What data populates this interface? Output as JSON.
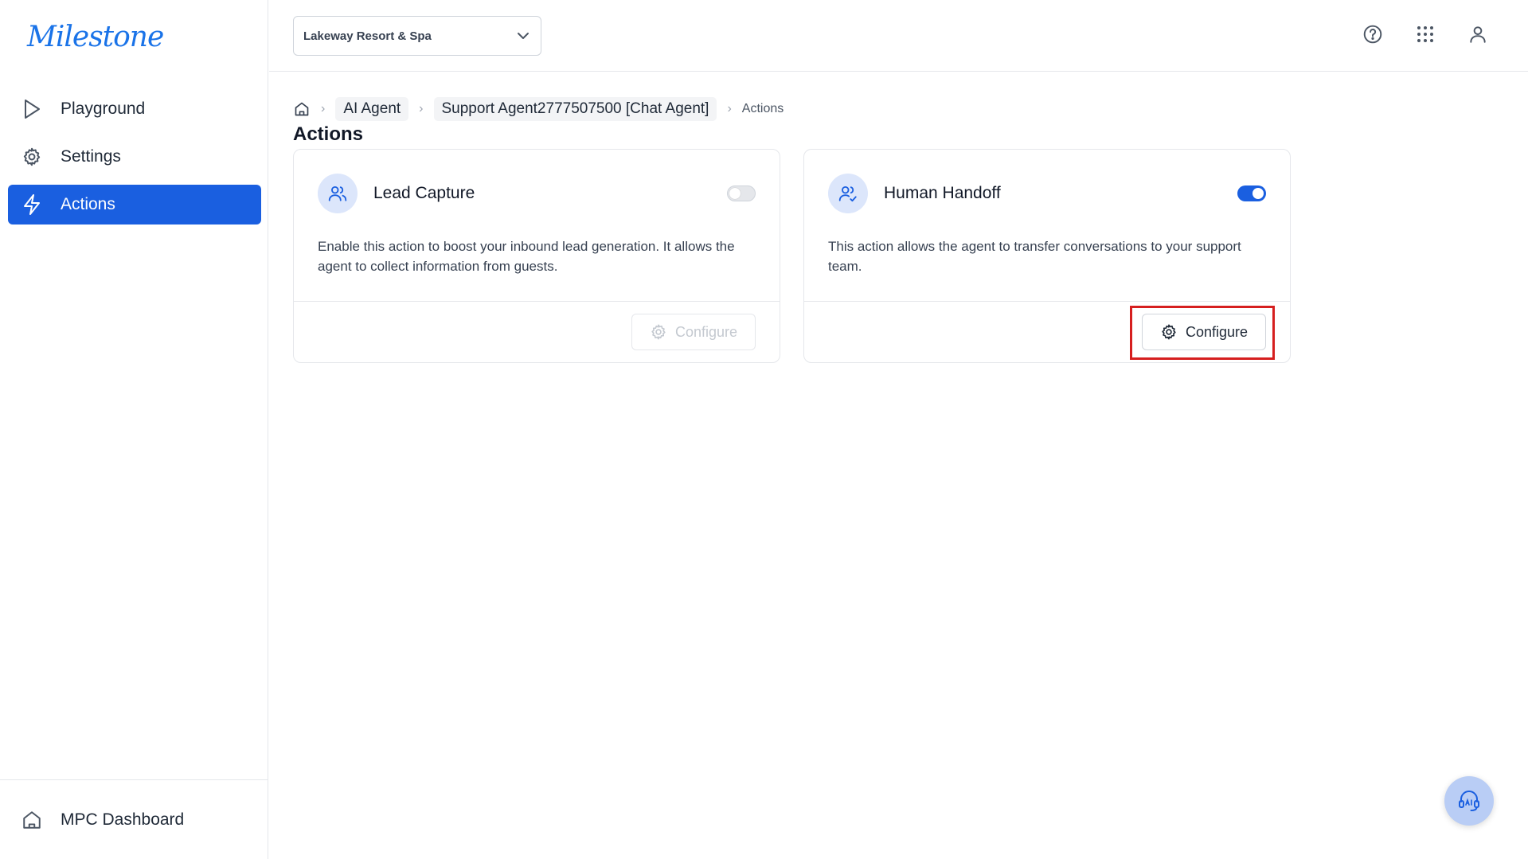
{
  "brand": {
    "logo_text": "Milestone",
    "color": "#1a73e8"
  },
  "sidebar": {
    "items": [
      {
        "label": "Playground",
        "icon": "play-icon",
        "active": false
      },
      {
        "label": "Settings",
        "icon": "gear-icon",
        "active": false
      },
      {
        "label": "Actions",
        "icon": "lightning-icon",
        "active": true
      }
    ],
    "footer": {
      "label": "MPC Dashboard",
      "icon": "home-icon"
    }
  },
  "topbar": {
    "property_select": {
      "value": "Lakeway Resort & Spa"
    },
    "icons": [
      "help-icon",
      "apps-grid-icon",
      "user-icon"
    ]
  },
  "breadcrumb": {
    "items": [
      "AI Agent",
      "Support Agent2777507500 [Chat Agent]",
      "Actions"
    ]
  },
  "page": {
    "title": "Actions"
  },
  "cards": [
    {
      "title": "Lead Capture",
      "description": "Enable this action to boost your inbound lead generation. It allows the agent to collect information from guests.",
      "enabled": false,
      "button_label": "Configure",
      "button_disabled": true
    },
    {
      "title": "Human Handoff",
      "description": "This action allows the agent to transfer conversations to your support team.",
      "enabled": true,
      "button_label": "Configure",
      "button_disabled": false
    }
  ],
  "colors": {
    "accent": "#1a5fe0",
    "highlight": "#d61f1f"
  }
}
